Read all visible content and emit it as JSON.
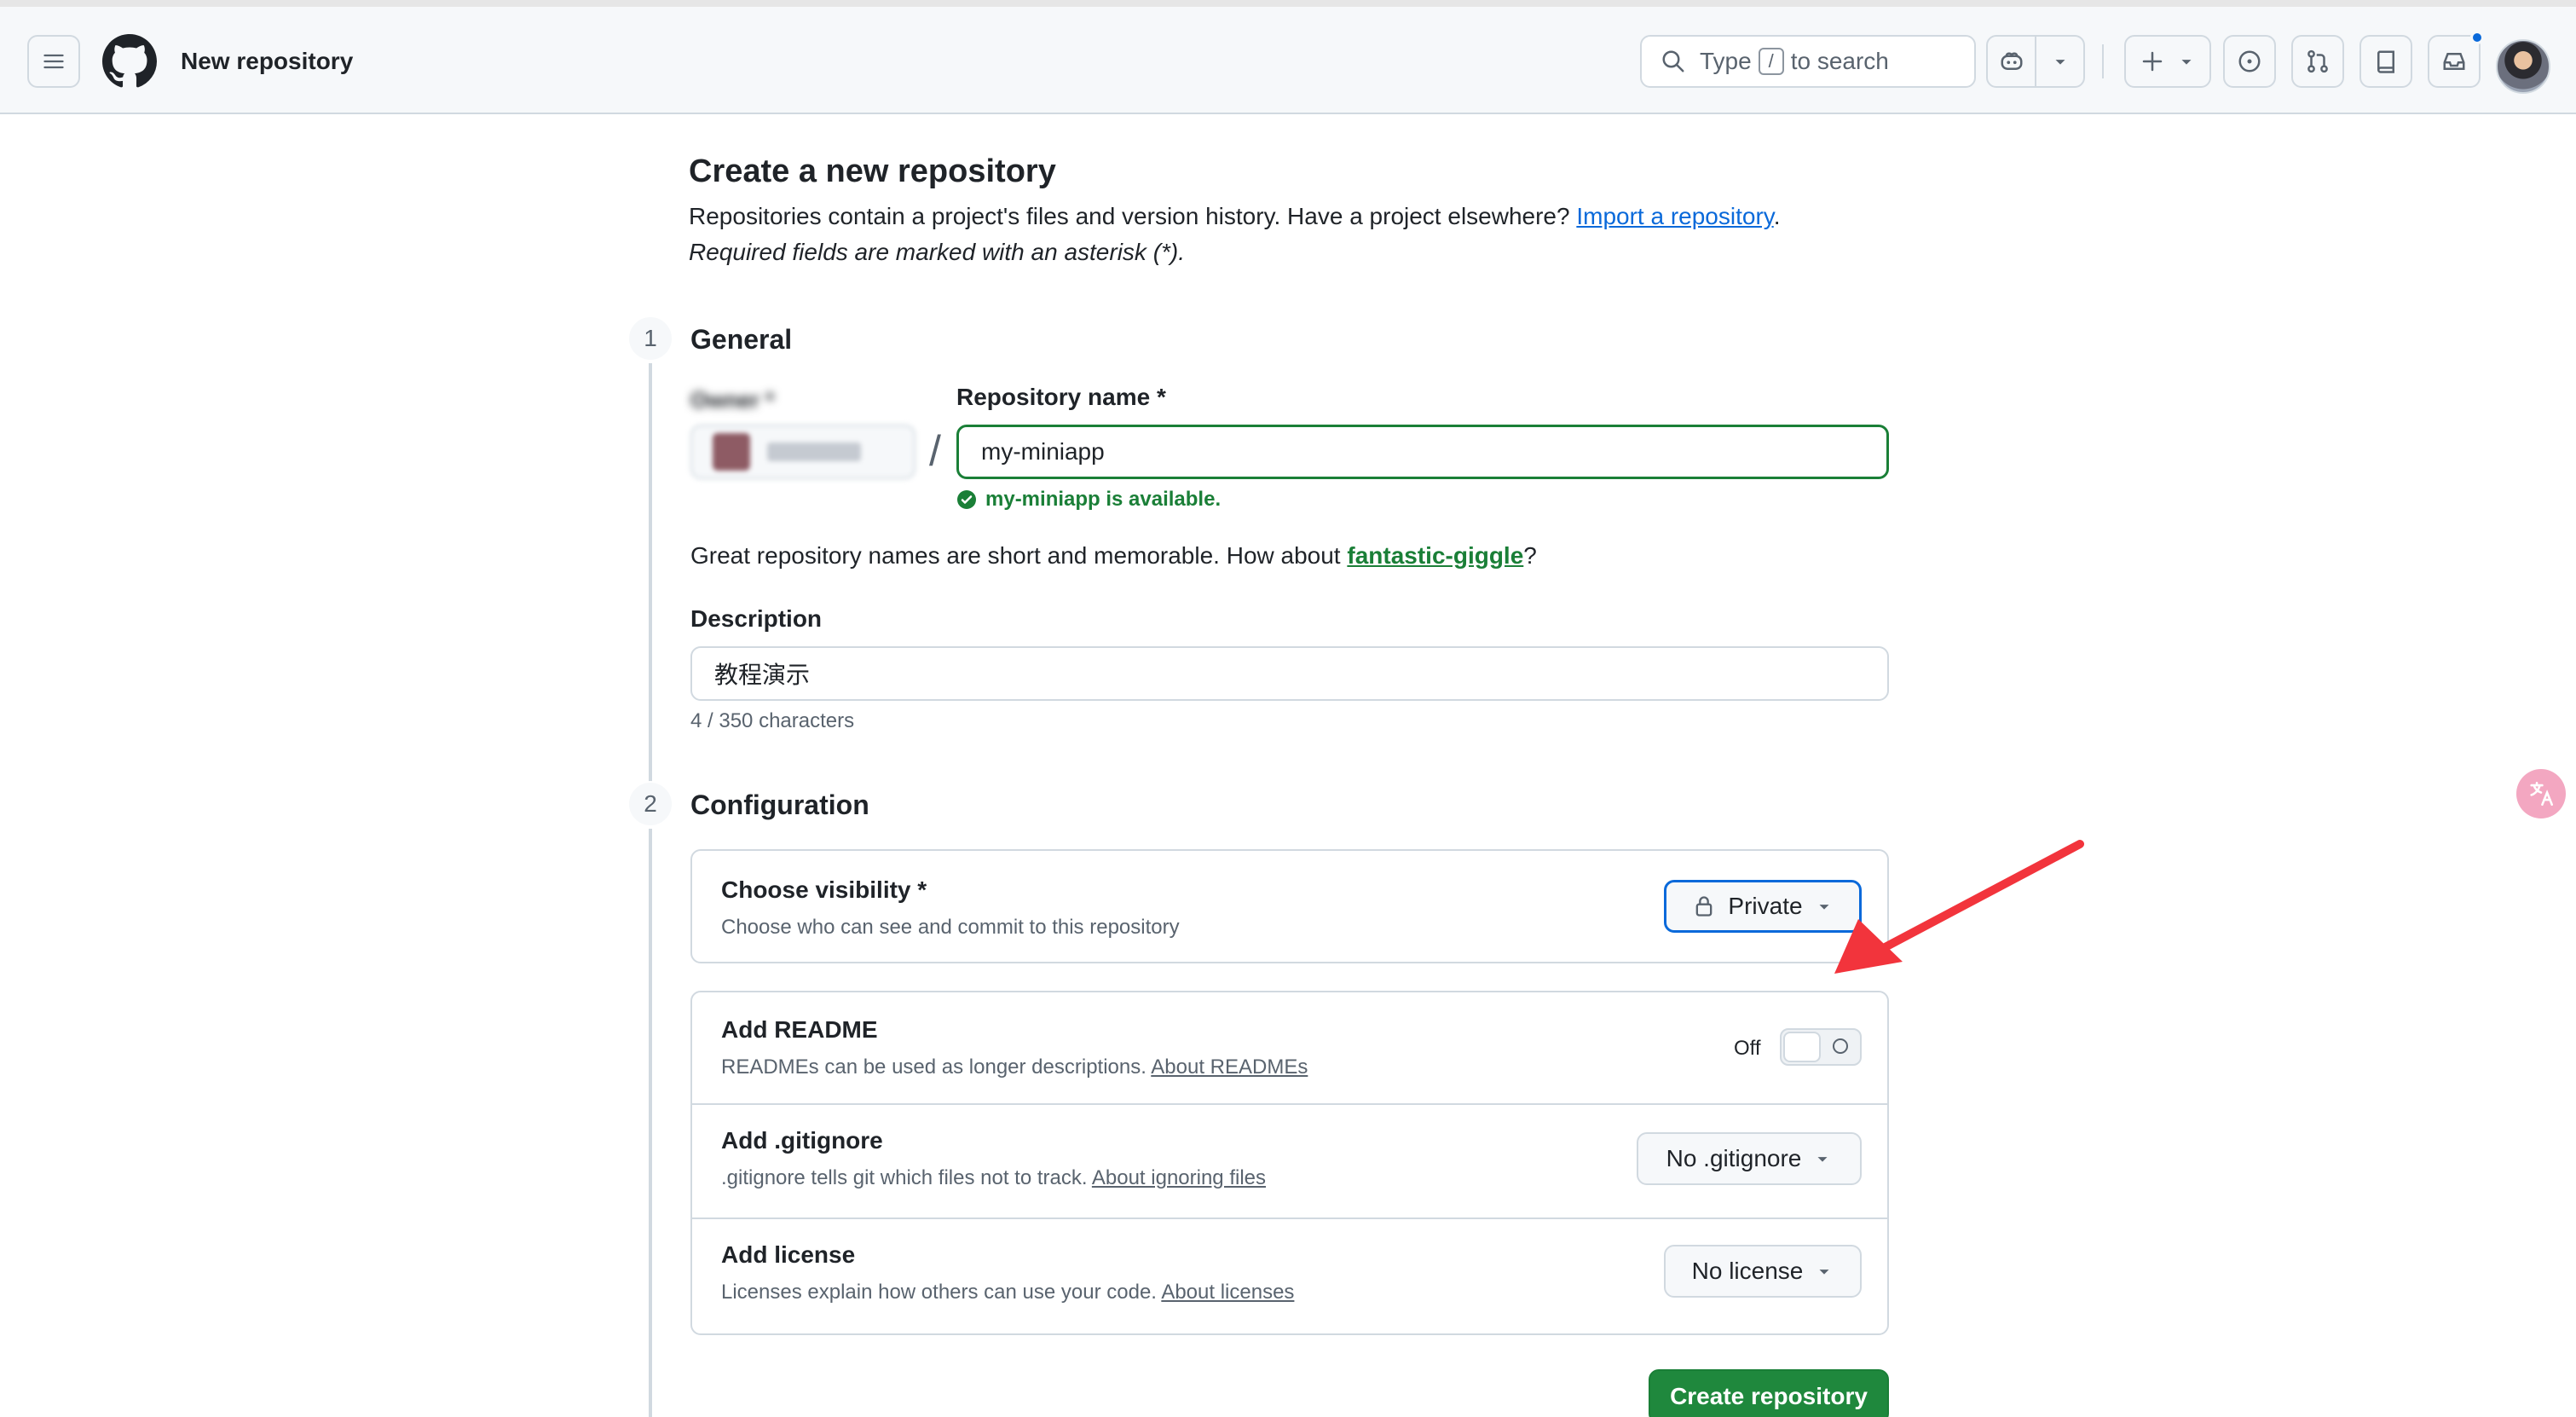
{
  "header": {
    "title": "New repository",
    "search": {
      "before": "Type",
      "key": "/",
      "after": "to search"
    },
    "icons": [
      "hamburger-icon",
      "github-logo-icon",
      "search-icon",
      "copilot-icon",
      "plus-icon",
      "issues-icon",
      "pull-requests-icon",
      "repositories-icon",
      "inbox-icon"
    ]
  },
  "page": {
    "heading": "Create a new repository",
    "intro_text": "Repositories contain a project's files and version history. Have a project elsewhere?",
    "import_link": "Import a repository",
    "intro_end": ".",
    "required_note": "Required fields are marked with an asterisk (*)."
  },
  "general": {
    "step": "1",
    "title": "General",
    "owner_label": "Owner *",
    "repo_name_label": "Repository name *",
    "repo_name_value": "my-miniapp",
    "available_text": "my-miniapp is available.",
    "suggest_prefix": "Great repository names are short and memorable. How about",
    "suggest_name": "fantastic-giggle",
    "suggest_suffix": "?",
    "description_label": "Description",
    "description_value": "教程演示",
    "char_count": "4 / 350 characters"
  },
  "configuration": {
    "step": "2",
    "title": "Configuration",
    "visibility": {
      "title": "Choose visibility *",
      "subtitle": "Choose who can see and commit to this repository",
      "value": "Private"
    },
    "readme": {
      "title": "Add README",
      "subtitle": "READMEs can be used as longer descriptions.",
      "link": "About READMEs",
      "toggle_label": "Off",
      "toggle_on": false
    },
    "gitignore": {
      "title": "Add .gitignore",
      "subtitle": ".gitignore tells git which files not to track.",
      "link": "About ignoring files",
      "value": "No .gitignore"
    },
    "license": {
      "title": "Add license",
      "subtitle": "Licenses explain how others can use your code.",
      "link": "About licenses",
      "value": "No license"
    }
  },
  "actions": {
    "create": "Create repository"
  },
  "colors": {
    "accent_blue": "#0969da",
    "success_green": "#1a7f37",
    "primary_button": "#1f883d",
    "annotation_red": "#f2343c"
  }
}
